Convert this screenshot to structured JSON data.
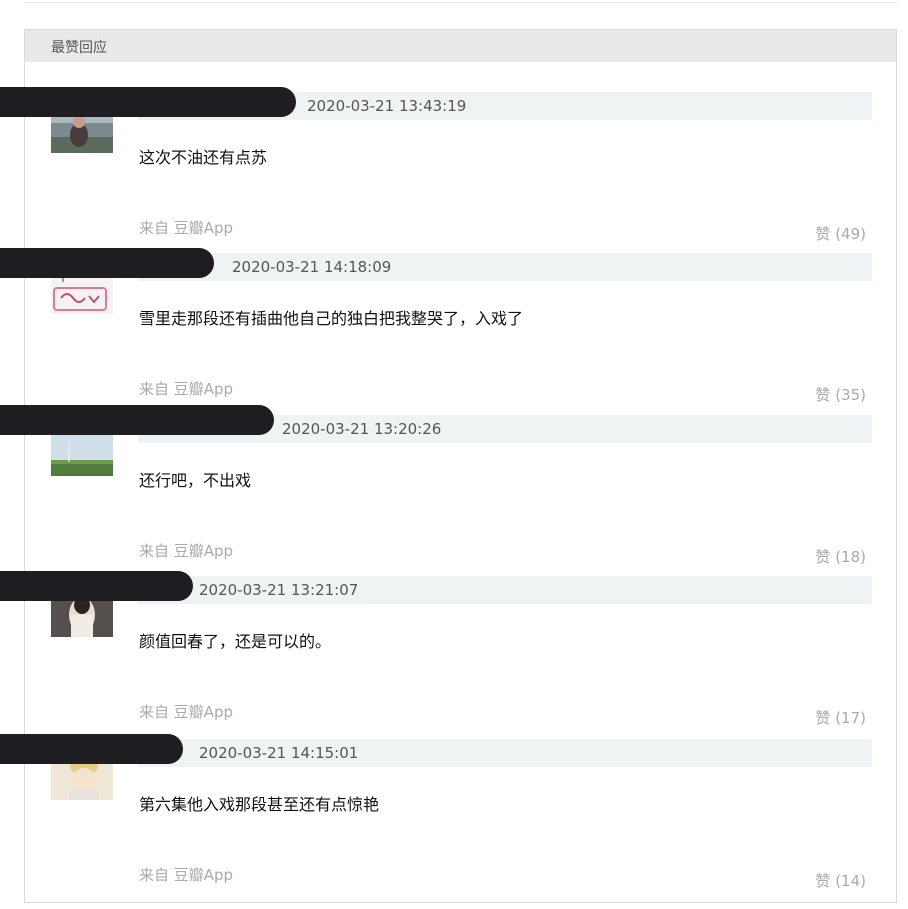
{
  "section": {
    "title": "最赞回应"
  },
  "comments": [
    {
      "username": "",
      "time": "2020-03-21 13:43:19",
      "text": "这次不油还有点苏",
      "source": "来自 豆瓣App",
      "vote_label": "赞",
      "vote_count": "(49)",
      "avatar": "avatar-1-icon"
    },
    {
      "username": "",
      "time": "2020-03-21 14:18:09",
      "text": "雪里走那段还有插曲他自己的独白把我整哭了，入戏了",
      "source": "来自 豆瓣App",
      "vote_label": "赞",
      "vote_count": "(35)",
      "avatar": "avatar-2-icon"
    },
    {
      "username": "",
      "time": "2020-03-21 13:20:26",
      "text": "还行吧，不出戏",
      "source": "来自 豆瓣App",
      "vote_label": "赞",
      "vote_count": "(18)",
      "avatar": "avatar-3-icon"
    },
    {
      "username": "",
      "time": "2020-03-21 13:21:07",
      "text": "颜值回春了，还是可以的。",
      "source": "来自 豆瓣App",
      "vote_label": "赞",
      "vote_count": "(17)",
      "avatar": "avatar-4-icon"
    },
    {
      "username": "",
      "time": "2020-03-21 14:15:01",
      "text": "第六集他入戏那段甚至还有点惊艳",
      "source": "来自 豆瓣App",
      "vote_label": "赞",
      "vote_count": "(14)",
      "avatar": "avatar-5-icon"
    }
  ]
}
